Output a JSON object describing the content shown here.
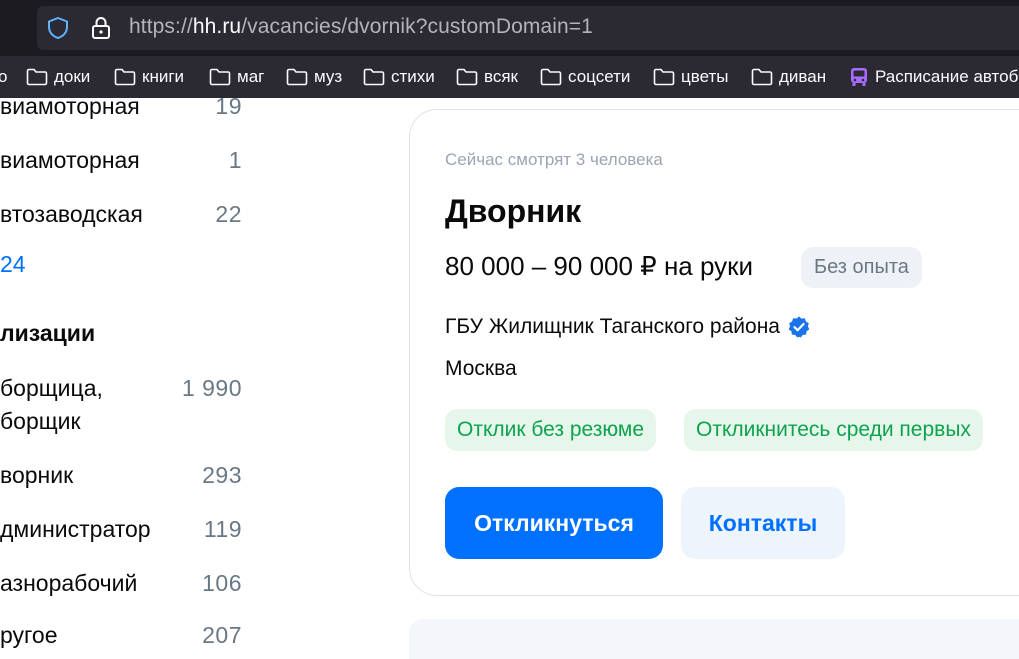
{
  "browser": {
    "url_prefix": "https://",
    "url_host": "hh.ru",
    "url_path": "/vacancies/dvornik?customDomain=1",
    "bookmarks": [
      {
        "label": "о",
        "icon": "folder-icon"
      },
      {
        "label": "доки",
        "icon": "folder-icon"
      },
      {
        "label": "книги",
        "icon": "folder-icon"
      },
      {
        "label": "маг",
        "icon": "folder-icon"
      },
      {
        "label": "муз",
        "icon": "folder-icon"
      },
      {
        "label": "стихи",
        "icon": "folder-icon"
      },
      {
        "label": "всяк",
        "icon": "folder-icon"
      },
      {
        "label": "соцсети",
        "icon": "folder-icon"
      },
      {
        "label": "цветы",
        "icon": "folder-icon"
      },
      {
        "label": "диван",
        "icon": "folder-icon"
      },
      {
        "label": "Расписание автоб",
        "icon": "bus-icon"
      }
    ]
  },
  "filters": {
    "metro": [
      {
        "label": "виамоторная",
        "count": "19"
      },
      {
        "label": "виамоторная",
        "count": "1"
      },
      {
        "label": "втозаводская",
        "count": "22"
      }
    ],
    "metro_more": "24",
    "specializations_title": "лизации",
    "specializations": [
      {
        "label": "борщица,",
        "label2": "борщик",
        "count": "1 990"
      },
      {
        "label": "ворник",
        "count": "293"
      },
      {
        "label": "дминистратор",
        "count": "119"
      },
      {
        "label": "азнорабочий",
        "count": "106"
      },
      {
        "label": "ругое",
        "count": "207"
      }
    ]
  },
  "vacancy": {
    "viewers": "Сейчас смотрят 3 человека",
    "title": "Дворник",
    "salary": "80 000 – 90 000 ₽ на руки",
    "experience": "Без опыта",
    "company": "ГБУ Жилищник Таганского района",
    "city": "Москва",
    "tags": [
      "Отклик без резюме",
      "Откликнитесь среди первых"
    ],
    "apply_label": "Откликнуться",
    "contacts_label": "Контакты"
  },
  "colors": {
    "accent": "#0070ff",
    "tag_green": "#0da34e",
    "verified": "#1a73e8"
  }
}
